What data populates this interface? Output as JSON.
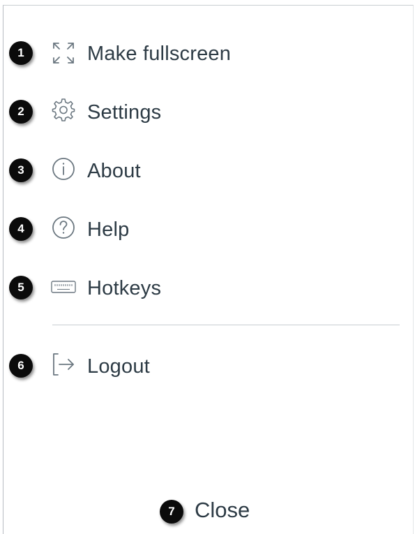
{
  "menu": {
    "items": [
      {
        "badge": "1",
        "label": "Make fullscreen",
        "icon": "fullscreen-icon"
      },
      {
        "badge": "2",
        "label": "Settings",
        "icon": "gear-icon"
      },
      {
        "badge": "3",
        "label": "About",
        "icon": "info-icon"
      },
      {
        "badge": "4",
        "label": "Help",
        "icon": "help-icon"
      },
      {
        "badge": "5",
        "label": "Hotkeys",
        "icon": "keyboard-icon"
      },
      {
        "badge": "6",
        "label": "Logout",
        "icon": "logout-icon"
      }
    ]
  },
  "close": {
    "badge": "7",
    "label": "Close"
  },
  "colors": {
    "text": "#2d3b45",
    "icon": "#6b7780",
    "badge_bg": "#0b0b0b",
    "divider": "#c7cdd1"
  }
}
